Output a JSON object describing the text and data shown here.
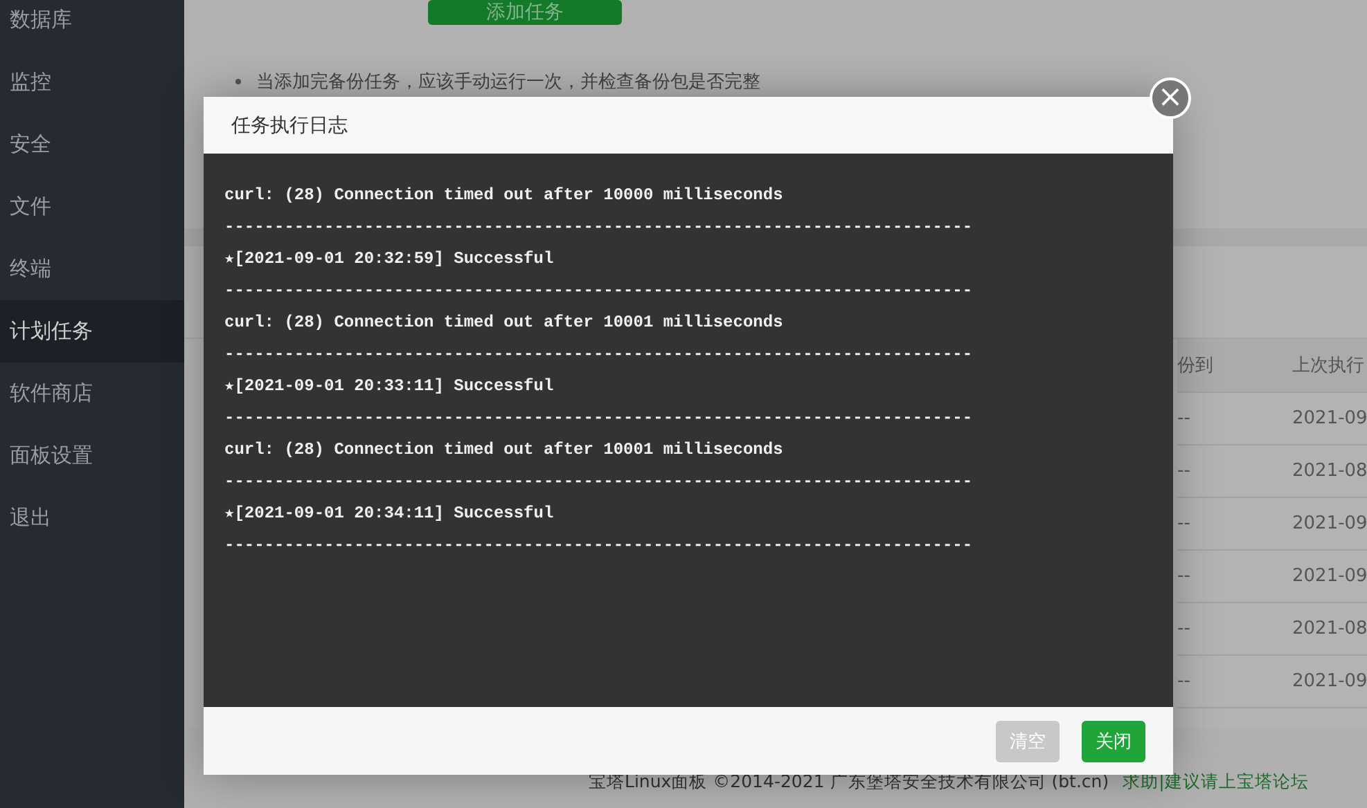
{
  "sidebar": {
    "items": [
      {
        "label": "数据库",
        "selected": false
      },
      {
        "label": "监控",
        "selected": false
      },
      {
        "label": "安全",
        "selected": false
      },
      {
        "label": "文件",
        "selected": false
      },
      {
        "label": "终端",
        "selected": false
      },
      {
        "label": "计划任务",
        "selected": true
      },
      {
        "label": "软件商店",
        "selected": false
      },
      {
        "label": "面板设置",
        "selected": false
      },
      {
        "label": "退出",
        "selected": false
      }
    ]
  },
  "page": {
    "add_button": "添加任务",
    "tip": "当添加完备份任务，应该手动运行一次，并检查备份包是否完整",
    "table": {
      "columns": [
        "份到",
        "上次执行"
      ],
      "rows": [
        [
          "--",
          "2021-09"
        ],
        [
          "--",
          "2021-08"
        ],
        [
          "--",
          "2021-09"
        ],
        [
          "--",
          "2021-09"
        ],
        [
          "--",
          "2021-08"
        ],
        [
          "--",
          "2021-09"
        ]
      ]
    }
  },
  "dialog": {
    "title": "任务执行日志",
    "close": "×",
    "log": [
      "curl: (28) Connection timed out after 10000 milliseconds",
      "---------------------------------------------------------------------------",
      "★[2021-09-01 20:32:59] Successful",
      "---------------------------------------------------------------------------",
      "curl: (28) Connection timed out after 10001 milliseconds",
      "---------------------------------------------------------------------------",
      "★[2021-09-01 20:33:11] Successful",
      "---------------------------------------------------------------------------",
      "curl: (28) Connection timed out after 10001 milliseconds",
      "---------------------------------------------------------------------------",
      "★[2021-09-01 20:34:11] Successful",
      "---------------------------------------------------------------------------"
    ],
    "buttons": [
      {
        "label": "清空",
        "kind": "secondary"
      },
      {
        "label": "关闭",
        "kind": "primary"
      }
    ]
  },
  "footer": {
    "copyright": "宝塔Linux面板 ©2014-2021 广东堡塔安全技术有限公司 (bt.cn)",
    "link": "求助|建议请上宝塔论坛"
  }
}
